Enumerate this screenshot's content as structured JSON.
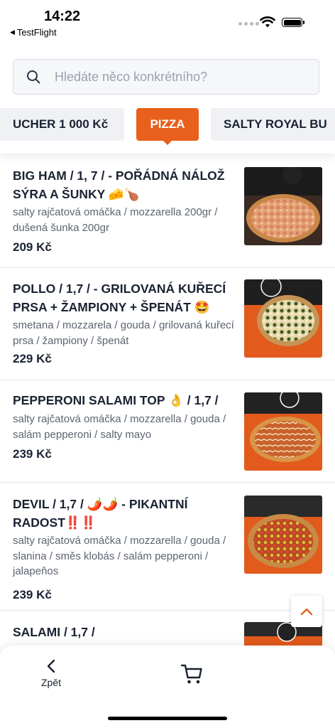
{
  "status": {
    "time": "14:22",
    "back_app": "TestFlight"
  },
  "search": {
    "placeholder": "Hledáte něco konkrétního?"
  },
  "categories": [
    {
      "label": "UCHER 1 000 Kč"
    },
    {
      "label": "PIZZA"
    },
    {
      "label": "SALTY ROYAL BU"
    }
  ],
  "items": [
    {
      "name": "BIG HAM / 1, 7 / - POŘÁDNÁ NÁLOŽ SÝRA A ŠUNKY 🧀🍗",
      "desc": "salty rajčatová omáčka / mozzarella 200gr / dušená šunka 200gr",
      "price": "209 Kč"
    },
    {
      "name": "POLLO / 1,7 / - GRILOVANÁ KUŘECÍ PRSA + ŽAMPIONY + ŠPENÁT 🤩",
      "desc": "smetana / mozzarela / gouda / grilovaná kuřecí prsa / žampiony / špenát",
      "price": "229 Kč"
    },
    {
      "name": "PEPPERONI SALAMI TOP 👌 / 1,7 /",
      "desc": "salty rajčatová omáčka / mozzarella / gouda / salám pepperoni / salty mayo",
      "price": "239 Kč"
    },
    {
      "name": "DEVIL / 1,7 / 🌶️🌶️ - PIKANTNÍ RADOST‼️‼️",
      "desc": "salty rajčatová omáčka / mozzarella / gouda / slanina / směs klobás / salám pepperoni / jalapeňos",
      "price": "239 Kč"
    },
    {
      "name": "SALAMI / 1,7 /",
      "desc": "",
      "price": ""
    }
  ],
  "nav": {
    "back_label": "Zpět"
  },
  "colors": {
    "accent": "#e8601c",
    "text": "#1a2233",
    "muted": "#5c6370"
  }
}
